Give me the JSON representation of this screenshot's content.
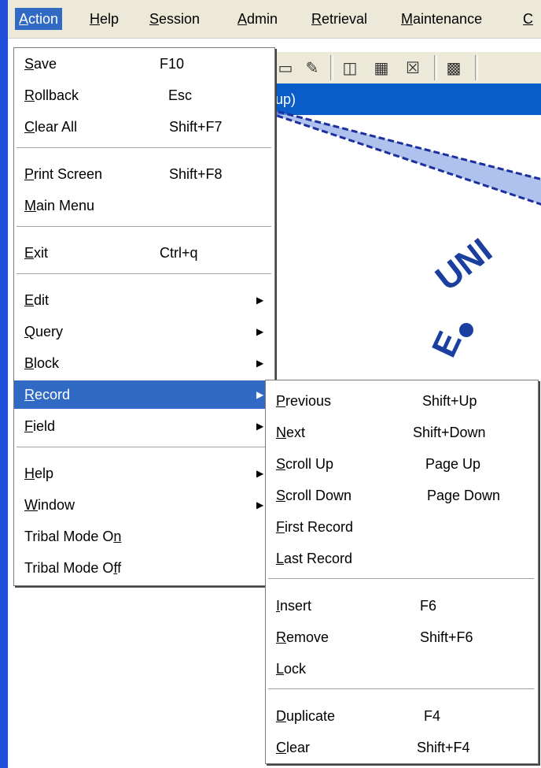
{
  "menubar": {
    "items": [
      {
        "mnemonic": "A",
        "rest": "ction"
      },
      {
        "mnemonic": "H",
        "rest": "elp"
      },
      {
        "mnemonic": "S",
        "rest": "ession"
      },
      {
        "mnemonic": "A",
        "rest": "dmin"
      },
      {
        "mnemonic": "R",
        "rest": "etrieval"
      },
      {
        "mnemonic": "M",
        "rest": "aintenance"
      },
      {
        "mnemonic": "C",
        "rest": ""
      }
    ]
  },
  "window": {
    "title_fragment": "up)"
  },
  "seal": {
    "text_1": "UNI",
    "text_2": "E"
  },
  "action_menu": {
    "items": [
      {
        "pre": "",
        "mn": "S",
        "post": "ave",
        "shortcut": "F10"
      },
      {
        "pre": "",
        "mn": "R",
        "post": "ollback",
        "shortcut": "Esc"
      },
      {
        "pre": "",
        "mn": "C",
        "post": "lear All",
        "shortcut": "Shift+F7"
      },
      {
        "pre": "",
        "mn": "P",
        "post": "rint Screen",
        "shortcut": "Shift+F8"
      },
      {
        "pre": "",
        "mn": "M",
        "post": "ain Menu",
        "shortcut": ""
      },
      {
        "pre": "",
        "mn": "E",
        "post": "xit",
        "shortcut": "Ctrl+q"
      },
      {
        "pre": "",
        "mn": "E",
        "post": "dit",
        "shortcut": ""
      },
      {
        "pre": "",
        "mn": "Q",
        "post": "uery",
        "shortcut": ""
      },
      {
        "pre": "",
        "mn": "B",
        "post": "lock",
        "shortcut": ""
      },
      {
        "pre": "",
        "mn": "R",
        "post": "ecord",
        "shortcut": ""
      },
      {
        "pre": "",
        "mn": "F",
        "post": "ield",
        "shortcut": ""
      },
      {
        "pre": "",
        "mn": "H",
        "post": "elp",
        "shortcut": ""
      },
      {
        "pre": "",
        "mn": "W",
        "post": "indow",
        "shortcut": ""
      },
      {
        "pre": "Tribal Mode O",
        "mn": "n",
        "post": "",
        "shortcut": ""
      },
      {
        "pre": "Tribal Mode O",
        "mn": "f",
        "post": "f",
        "shortcut": ""
      }
    ]
  },
  "record_menu": {
    "items": [
      {
        "mn": "P",
        "post": "revious",
        "shortcut": "Shift+Up"
      },
      {
        "mn": "N",
        "post": "ext",
        "shortcut": "Shift+Down"
      },
      {
        "mn": "S",
        "post": "croll Up",
        "shortcut": "Page Up"
      },
      {
        "mn": "S",
        "post": "croll Down",
        "shortcut": "Page Down"
      },
      {
        "mn": "F",
        "post": "irst Record",
        "shortcut": ""
      },
      {
        "mn": "L",
        "post": "ast Record",
        "shortcut": ""
      },
      {
        "mn": "I",
        "post": "nsert",
        "shortcut": "F6"
      },
      {
        "mn": "R",
        "post": "emove",
        "shortcut": "Shift+F6"
      },
      {
        "mn": "L",
        "post": "ock",
        "shortcut": ""
      },
      {
        "mn": "D",
        "post": "uplicate",
        "shortcut": "F4"
      },
      {
        "mn": "C",
        "post": "lear",
        "shortcut": "Shift+F4"
      }
    ]
  },
  "colors": {
    "highlight": "#316ac5",
    "arrow": "#1b2f9e"
  }
}
